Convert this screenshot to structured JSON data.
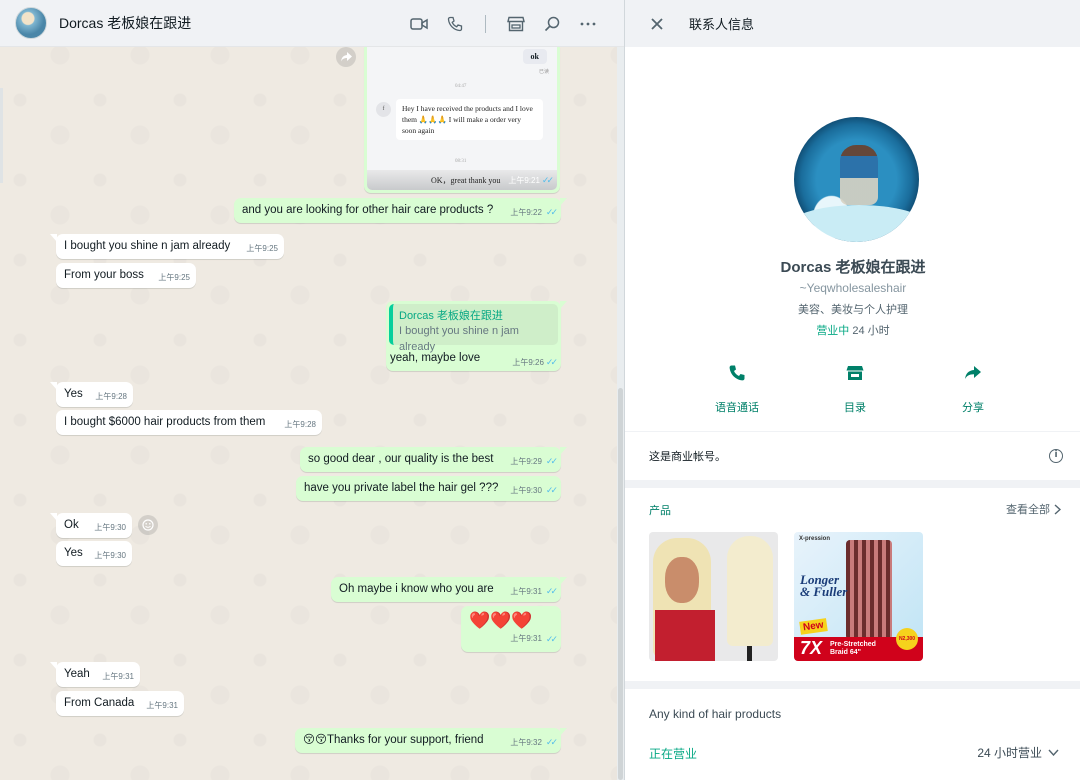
{
  "chat": {
    "contact_name": "Dorcas 老板娘在跟进",
    "header_icons": [
      "video-icon",
      "phone-icon",
      "catalog-icon",
      "search-icon",
      "menu-icon"
    ],
    "image_message": {
      "ok_text": "ok",
      "ok_sub": "已读",
      "time_1": "04:47",
      "sender_initial": "f",
      "received_text": "Hey I have received the products and I love them 🙏🙏🙏 I will make a order very soon again",
      "time_2": "08:31",
      "bottom_text": "OK，great thank you ",
      "time": "上午9:21"
    },
    "messages": [
      {
        "dir": "out",
        "text": "and you are looking for other hair care products ?",
        "time": "上午9:22"
      },
      {
        "dir": "in",
        "text": "I bought you shine n jam already",
        "time": "上午9:25"
      },
      {
        "dir": "in",
        "text": "From your boss",
        "time": "上午9:25"
      },
      {
        "dir": "in",
        "text": "Yes",
        "time": "上午9:28"
      },
      {
        "dir": "in",
        "text": "I bought $6000 hair products from them",
        "time": "上午9:28"
      },
      {
        "dir": "out",
        "text": "so good dear , our quality is the best",
        "time": "上午9:29"
      },
      {
        "dir": "out",
        "text": "have you private label the hair gel ???",
        "time": "上午9:30"
      },
      {
        "dir": "in",
        "text": "Ok",
        "time": "上午9:30"
      },
      {
        "dir": "in",
        "text": "Yes",
        "time": "上午9:30"
      },
      {
        "dir": "out",
        "text": "Oh maybe i know who you are",
        "time": "上午9:31"
      },
      {
        "dir": "out",
        "text": "❤️❤️❤️",
        "time": "上午9:31"
      },
      {
        "dir": "in",
        "text": "Yeah",
        "time": "上午9:31"
      },
      {
        "dir": "in",
        "text": "From Canada",
        "time": "上午9:31"
      },
      {
        "dir": "out",
        "text": "😚😚Thanks for your support, friend",
        "time": "上午9:32"
      }
    ],
    "reply": {
      "quoted_name": "Dorcas 老板娘在跟进",
      "quoted_text": "I bought you shine n jam already",
      "text": "yeah, maybe love",
      "time": "上午9:26"
    }
  },
  "info": {
    "title": "联系人信息",
    "name": "Dorcas 老板娘在跟进",
    "username": "~Yeqwholesaleshair",
    "category": "美容、美妆与个人护理",
    "status_open": "营业中",
    "status_hours": "24 小时",
    "actions": [
      {
        "label": "语音通话",
        "icon": "phone-icon"
      },
      {
        "label": "目录",
        "icon": "catalog-icon"
      },
      {
        "label": "分享",
        "icon": "share-icon"
      }
    ],
    "business_note": "这是商业帐号。",
    "products": {
      "title": "产品",
      "view_all": "查看全部",
      "item1": {
        "alt": "blonde-wig-product"
      },
      "item2": {
        "brand": "X-pression",
        "title_line1": "Longer",
        "title_line2": "& Fuller",
        "new_badge": "New",
        "big_label": "7X",
        "sub_line1": "Pre-Stretched",
        "sub_line2": "Braid 64\"",
        "price": "N2,300"
      }
    },
    "description": "Any kind of hair products",
    "open_status": "正在营业",
    "open_hours": "24 小时营业"
  },
  "colors": {
    "outgoing_bubble": "#d9fdd3",
    "incoming_bubble": "#ffffff",
    "accent_green": "#008069",
    "read_ticks": "#53bdeb"
  }
}
